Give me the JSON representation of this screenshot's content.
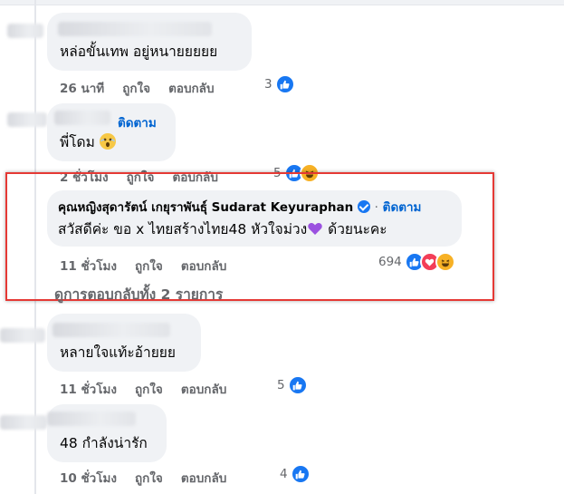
{
  "comments": [
    {
      "text": "หล่อขั้นเทพ อยู่หนายยยยย",
      "time": "26 นาที",
      "like": "ถูกใจ",
      "reply": "ตอบกลับ",
      "reaction_count": "3"
    },
    {
      "follow": "ติดตาม",
      "text": "พี่โดม",
      "time": "2 ชั่วโมง",
      "like": "ถูกใจ",
      "reply": "ตอบกลับ",
      "reaction_count": "5"
    },
    {
      "author": "คุณหญิงสุดารัตน์ เกยุราพันธุ์ Sudarat Keyuraphan",
      "follow": "ติดตาม",
      "separator": "·",
      "text_part1": "สวัสดีค่ะ ขอ x ไทยสร้างไทย48 หัวใจม่วง",
      "text_part2": "ด้วยนะคะ",
      "time": "11 ชั่วโมง",
      "like": "ถูกใจ",
      "reply": "ตอบกลับ",
      "reaction_count": "694",
      "view_replies": "ดูการตอบกลับทั้ง 2 รายการ"
    },
    {
      "text": "หลายใจแท้ะอ้ายยย",
      "time": "11 ชั่วโมง",
      "like": "ถูกใจ",
      "reply": "ตอบกลับ",
      "reaction_count": "5"
    },
    {
      "text": "48 กำลังน่ารัก",
      "time": "10 ชั่วโมง",
      "like": "ถูกใจ",
      "reply": "ตอบกลับ",
      "reaction_count": "4"
    }
  ],
  "colors": {
    "bubble": "#f0f2f5",
    "link": "#0064d1",
    "meta": "#65676b",
    "highlight_box": "#e53935",
    "like": "#1877f2",
    "love": "#f33e58",
    "haha": "#f7b125"
  }
}
